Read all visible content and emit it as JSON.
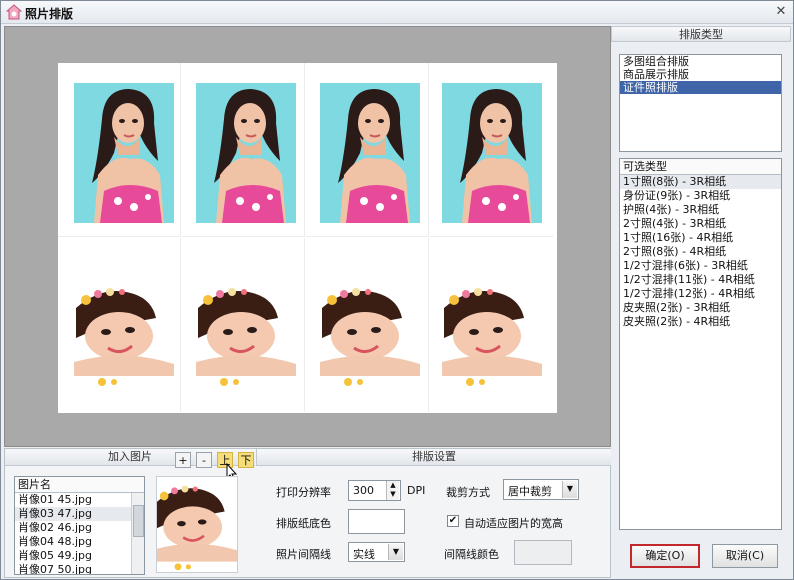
{
  "window": {
    "title": "照片排版",
    "close_glyph": "✕"
  },
  "layout_types": {
    "header": "排版类型",
    "items": [
      "多图组合排版",
      "商品展示排版",
      "证件照排版"
    ],
    "selected_index": 2
  },
  "optional_types": {
    "header": "可选类型",
    "items": [
      "1寸照(8张) - 3R相纸",
      "身份证(9张) - 3R相纸",
      "护照(4张) - 3R相纸",
      "2寸照(4张) - 3R相纸",
      "1寸照(16张) - 4R相纸",
      "2寸照(8张) - 4R相纸",
      "1/2寸混排(6张) - 3R相纸",
      "1/2寸混排(11张) - 4R相纸",
      "1/2寸混排(12张) - 4R相纸",
      "皮夹照(2张) - 3R相纸",
      "皮夹照(2张) - 4R相纸"
    ],
    "selected_index": 0
  },
  "add_images": {
    "header": "加入图片",
    "buttons": {
      "add": "+",
      "remove": "-",
      "up": "上",
      "down": "下"
    },
    "list_header": "图片名",
    "files": [
      "肖像01 45.jpg",
      "肖像03 47.jpg",
      "肖像02 46.jpg",
      "肖像04 48.jpg",
      "肖像05 49.jpg",
      "肖像07 50.jpg"
    ],
    "highlighted_index": 1
  },
  "settings": {
    "header": "排版设置",
    "dpi_label": "打印分辨率",
    "dpi_value": "300",
    "dpi_unit": "DPI",
    "crop_label": "裁剪方式",
    "crop_value": "居中裁剪",
    "paper_color_label": "排版纸底色",
    "auto_fit_label": "自动适应图片的宽高",
    "auto_fit_checked": true,
    "spacing_label": "照片间隔线",
    "spacing_value": "实线",
    "spacing_color_label": "间隔线颜色"
  },
  "footer": {
    "ok": "确定(O)",
    "cancel": "取消(C)"
  },
  "colors": {
    "selection": "#3f65a8",
    "photo_bg_cyan": "#7fd9e0",
    "highlight_button": "#f5dd7a",
    "ok_border": "#c0282c"
  }
}
